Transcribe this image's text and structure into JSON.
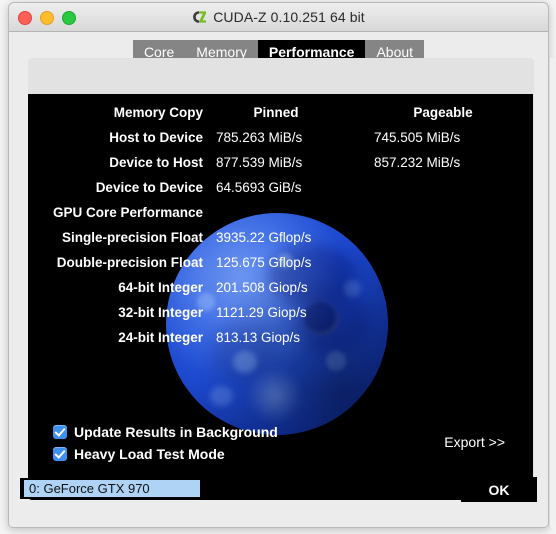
{
  "window": {
    "title": "CUDA-Z 0.10.251 64 bit",
    "icon": "cuda-z-logo-icon",
    "traffic_lights": [
      "close",
      "minimize",
      "maximize"
    ]
  },
  "tabs": [
    {
      "label": "Core",
      "active": false
    },
    {
      "label": "Memory",
      "active": false
    },
    {
      "label": "Performance",
      "active": true
    },
    {
      "label": "About",
      "active": false
    }
  ],
  "results": {
    "headers": {
      "label": "Memory Copy",
      "pinned": "Pinned",
      "pageable": "Pageable"
    },
    "rows": [
      {
        "label": "Host to Device",
        "pinned": "785.263 MiB/s",
        "pageable": "745.505 MiB/s"
      },
      {
        "label": "Device to Host",
        "pinned": "877.539 MiB/s",
        "pageable": "857.232 MiB/s"
      },
      {
        "label": "Device to Device",
        "pinned": "64.5693 GiB/s",
        "pageable": ""
      }
    ],
    "section_header": "GPU Core Performance",
    "perf_rows": [
      {
        "label": "Single-precision Float",
        "value": "3935.22 Gflop/s"
      },
      {
        "label": "Double-precision Float",
        "value": "125.675 Gflop/s"
      },
      {
        "label": "64-bit Integer",
        "value": "201.508 Giop/s"
      },
      {
        "label": "32-bit Integer",
        "value": "1121.29 Giop/s"
      },
      {
        "label": "24-bit Integer",
        "value": "813.13 Giop/s"
      }
    ]
  },
  "options": [
    {
      "label": "Update Results in Background",
      "checked": true
    },
    {
      "label": "Heavy Load Test Mode",
      "checked": true
    }
  ],
  "export": {
    "label": "Export >>"
  },
  "bottom": {
    "device_selected": "0: GeForce GTX 970",
    "ok_label": "OK"
  },
  "colors": {
    "panel_bg": "#000000",
    "tab_inactive": "#858585",
    "tab_active": "#000000",
    "checkbox": "#3d8ff0",
    "selection_highlight": "#aed3f4",
    "moon_blue": "#2f62e4",
    "window_chrome": "#ececec"
  }
}
